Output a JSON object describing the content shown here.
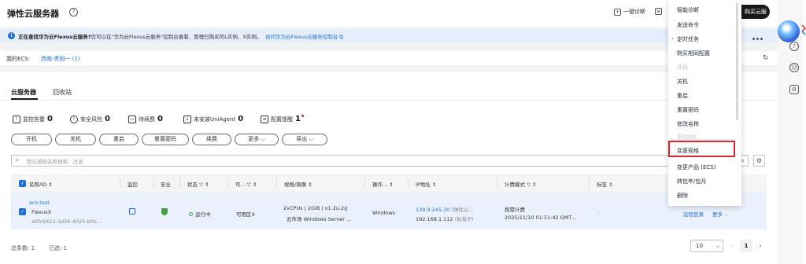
{
  "header": {
    "title": "弹性云服务器",
    "btn_diag": "一键诊断",
    "btn_buy": "购买云服务器"
  },
  "banner": {
    "text_bold": "正在查找华为云Flexus云服务?",
    "text_rest": "您可以在\"华为云Flexus云服务\"控制台查看、管理已购买的L实例、X实例。",
    "link": "访问华为云Flexus云服务控制台"
  },
  "region": {
    "label": "我的ECS:",
    "value": "西南-贵阳一 (1)"
  },
  "tabs": [
    {
      "label": "云服务器"
    },
    {
      "label": "回收站"
    }
  ],
  "stats": [
    {
      "label": "监控告警",
      "value": "0"
    },
    {
      "label": "安全风险",
      "value": "0"
    },
    {
      "label": "待续费",
      "value": "0"
    },
    {
      "label": "未安装UniAgent",
      "value": "0"
    },
    {
      "label": "配置提醒",
      "value": "1"
    }
  ],
  "actions": [
    "开机",
    "关机",
    "重启",
    "重置密码",
    "续费",
    "更多",
    "导出"
  ],
  "search": {
    "placeholder": "默认按照名称搜索、过滤"
  },
  "table": {
    "headers": [
      "名称/ID",
      "监控",
      "安全",
      "状态",
      "可...",
      "规格/镜像",
      "操作...",
      "IP地址",
      "计费模式",
      "标签"
    ],
    "row": {
      "name": "ecs-test",
      "type": "FlexusX",
      "id": "a0fc6412-3d36-4025-b0a...",
      "status": "运行中",
      "az": "可用区4",
      "spec": "2vCPUs | 2GiB | x1.2u.2g",
      "image": "云市场  Windows Server ...",
      "os": "Windows",
      "eip": "139.9.245.30",
      "eip_note": "(弹性公...",
      "private_ip": "192.168.1.112",
      "private_note": "(私有IP)",
      "billing": "按需计费",
      "billing_time": "2025/11/10 01:51:42 GMT...",
      "op_login": "远程登录",
      "op_more": "更多"
    }
  },
  "footer": {
    "total": "总条数:  1",
    "selected": "已选:  1",
    "page_size": "10",
    "page": "1"
  },
  "menu": {
    "items": [
      {
        "label": "智能诊断",
        "disabled": false
      },
      {
        "label": "发送命令",
        "disabled": false
      },
      {
        "label": "定时任务",
        "disabled": false
      },
      {
        "label": "购买相同配置",
        "disabled": false
      },
      {
        "label": "开机",
        "disabled": true
      },
      {
        "label": "关机",
        "disabled": false
      },
      {
        "label": "重启",
        "disabled": false
      },
      {
        "label": "重置密码",
        "disabled": false
      },
      {
        "label": "修改名称",
        "disabled": false
      },
      {
        "label": "更改主机名",
        "disabled": true
      },
      {
        "label": "变更规格",
        "disabled": false
      },
      {
        "label": "变更产品 (ECS)",
        "disabled": false
      },
      {
        "label": "转包年/包月",
        "disabled": false
      },
      {
        "label": "删除",
        "disabled": false
      }
    ]
  },
  "colors": {
    "primary": "#1f6fd8",
    "highlight": "#e0242d",
    "success": "#3fa33f"
  }
}
